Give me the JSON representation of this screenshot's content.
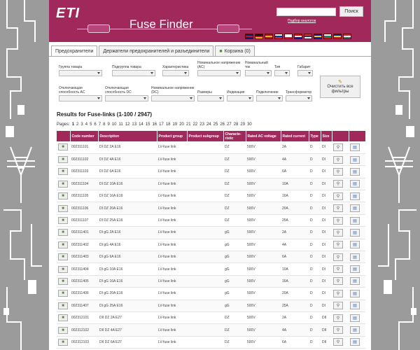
{
  "header": {
    "logo": "ETI",
    "title": "Fuse Finder",
    "search_button": "Поиск",
    "analog_link": "Подбор аналогов",
    "flags": [
      {
        "name": "uk-flag",
        "colors": [
          "#012169",
          "#C8102E",
          "#012169"
        ]
      },
      {
        "name": "germany-flag",
        "colors": [
          "#000000",
          "#DD0000",
          "#FFCE00"
        ]
      },
      {
        "name": "spain-flag",
        "colors": [
          "#AA151B",
          "#F1BF00",
          "#AA151B"
        ]
      },
      {
        "name": "russia-flag",
        "colors": [
          "#FFFFFF",
          "#0039A6",
          "#D52B1E"
        ]
      },
      {
        "name": "poland-flag",
        "colors": [
          "#FFFFFF",
          "#FFFFFF",
          "#DC143C"
        ]
      },
      {
        "name": "croatia-flag",
        "colors": [
          "#FF0000",
          "#FFFFFF",
          "#171796"
        ]
      },
      {
        "name": "serbia-flag",
        "colors": [
          "#C6363C",
          "#0C4076",
          "#FFFFFF"
        ]
      },
      {
        "name": "bosnia-flag",
        "colors": [
          "#002395",
          "#FECB00",
          "#002395"
        ]
      },
      {
        "name": "bulgaria-flag",
        "colors": [
          "#FFFFFF",
          "#00966E",
          "#D62612"
        ]
      },
      {
        "name": "romania-flag",
        "colors": [
          "#002B7F",
          "#FCD116",
          "#CE1126"
        ]
      },
      {
        "name": "hungary-flag",
        "colors": [
          "#CE2939",
          "#FFFFFF",
          "#477050"
        ]
      }
    ]
  },
  "tabs": [
    "Предохранители",
    "Держатели предохранителей и разъединители",
    "Корзина (0)"
  ],
  "filters": {
    "row1": [
      "Группа товара",
      "Подгруппа товара",
      "Характеристика",
      "Номинальное напряжение (AC)",
      "Номинальный ток",
      "Тип",
      "Габарит"
    ],
    "row2": [
      "Отключающая способность AC",
      "Отключающая способность DC",
      "Номинальное напряжение (DC)",
      "Размеры",
      "Индикация",
      "Подключение",
      "Трансформатор"
    ],
    "clear_button": "Очистить все фильтры"
  },
  "results": {
    "title": "Results for Fuse-links (1-100 / 2947)",
    "pages_label": "Pages:",
    "pages": [
      "1",
      "2",
      "3",
      "4",
      "5",
      "6",
      "7",
      "8",
      "9",
      "10",
      "11",
      "12",
      "13",
      "14",
      "15",
      "16",
      "17",
      "18",
      "19",
      "20",
      "21",
      "22",
      "23",
      "24",
      "25",
      "26",
      "27",
      "28",
      "29",
      "30"
    ],
    "current_page": "1"
  },
  "table": {
    "headers": [
      "",
      "Code number",
      "Description",
      "Product group",
      "Product subgroup",
      "Characte-ristic",
      "Rated AC voltage",
      "Rated current",
      "Type",
      "Size",
      "",
      ""
    ],
    "rows": [
      [
        "002311101",
        "DI DZ 2A E16",
        "LV-fuse link",
        "",
        "DZ",
        "500V",
        "2A",
        "D",
        "DI"
      ],
      [
        "002311102",
        "DI DZ 4A E16",
        "LV-fuse link",
        "",
        "DZ",
        "500V",
        "4A",
        "D",
        "DI"
      ],
      [
        "002311103",
        "DI DZ 6A E16",
        "LV-fuse link",
        "",
        "DZ",
        "500V",
        "6A",
        "D",
        "DI"
      ],
      [
        "002311104",
        "DI DZ 10A E16",
        "LV-fuse link",
        "",
        "DZ",
        "500V",
        "10A",
        "D",
        "DI"
      ],
      [
        "002311105",
        "DI DZ 16A E16",
        "LV-fuse link",
        "",
        "DZ",
        "500V",
        "16A",
        "D",
        "DI"
      ],
      [
        "002311106",
        "DI DZ 20A E16",
        "LV-fuse link",
        "",
        "DZ",
        "500V",
        "20A",
        "D",
        "DI"
      ],
      [
        "002311107",
        "DI DZ 25A E16",
        "LV-fuse link",
        "",
        "DZ",
        "500V",
        "25A",
        "D",
        "DI"
      ],
      [
        "002311401",
        "DI gG 2A E16",
        "LV-fuse link",
        "",
        "gG",
        "500V",
        "2A",
        "D",
        "DI"
      ],
      [
        "002311402",
        "DI gG 4A E16",
        "LV-fuse link",
        "",
        "gG",
        "500V",
        "4A",
        "D",
        "DI"
      ],
      [
        "002311403",
        "DI gG 6A E16",
        "LV-fuse link",
        "",
        "gG",
        "500V",
        "6A",
        "D",
        "DI"
      ],
      [
        "002311404",
        "DI gG 10A E16",
        "LV-fuse link",
        "",
        "gG",
        "500V",
        "10A",
        "D",
        "DI"
      ],
      [
        "002311405",
        "DI gG 16A E16",
        "LV-fuse link",
        "",
        "gG",
        "500V",
        "16A",
        "D",
        "DI"
      ],
      [
        "002311406",
        "DI gG 20A E16",
        "LV-fuse link",
        "",
        "gG",
        "500V",
        "20A",
        "D",
        "DI"
      ],
      [
        "002311407",
        "DI gG 25A E16",
        "LV-fuse link",
        "",
        "gG",
        "500V",
        "25A",
        "D",
        "DI"
      ],
      [
        "002312101",
        "DII DZ 2A E27",
        "LV-fuse link",
        "",
        "DZ",
        "500V",
        "2A",
        "D",
        "DII"
      ],
      [
        "002312102",
        "DII DZ 4A E27",
        "LV-fuse link",
        "",
        "DZ",
        "500V",
        "4A",
        "D",
        "DII"
      ],
      [
        "002312103",
        "DII DZ 6A E27",
        "LV-fuse link",
        "",
        "DZ",
        "500V",
        "6A",
        "D",
        "DII"
      ]
    ]
  },
  "colors": {
    "brand": "#a0285a",
    "side": "#9b9b9b"
  }
}
